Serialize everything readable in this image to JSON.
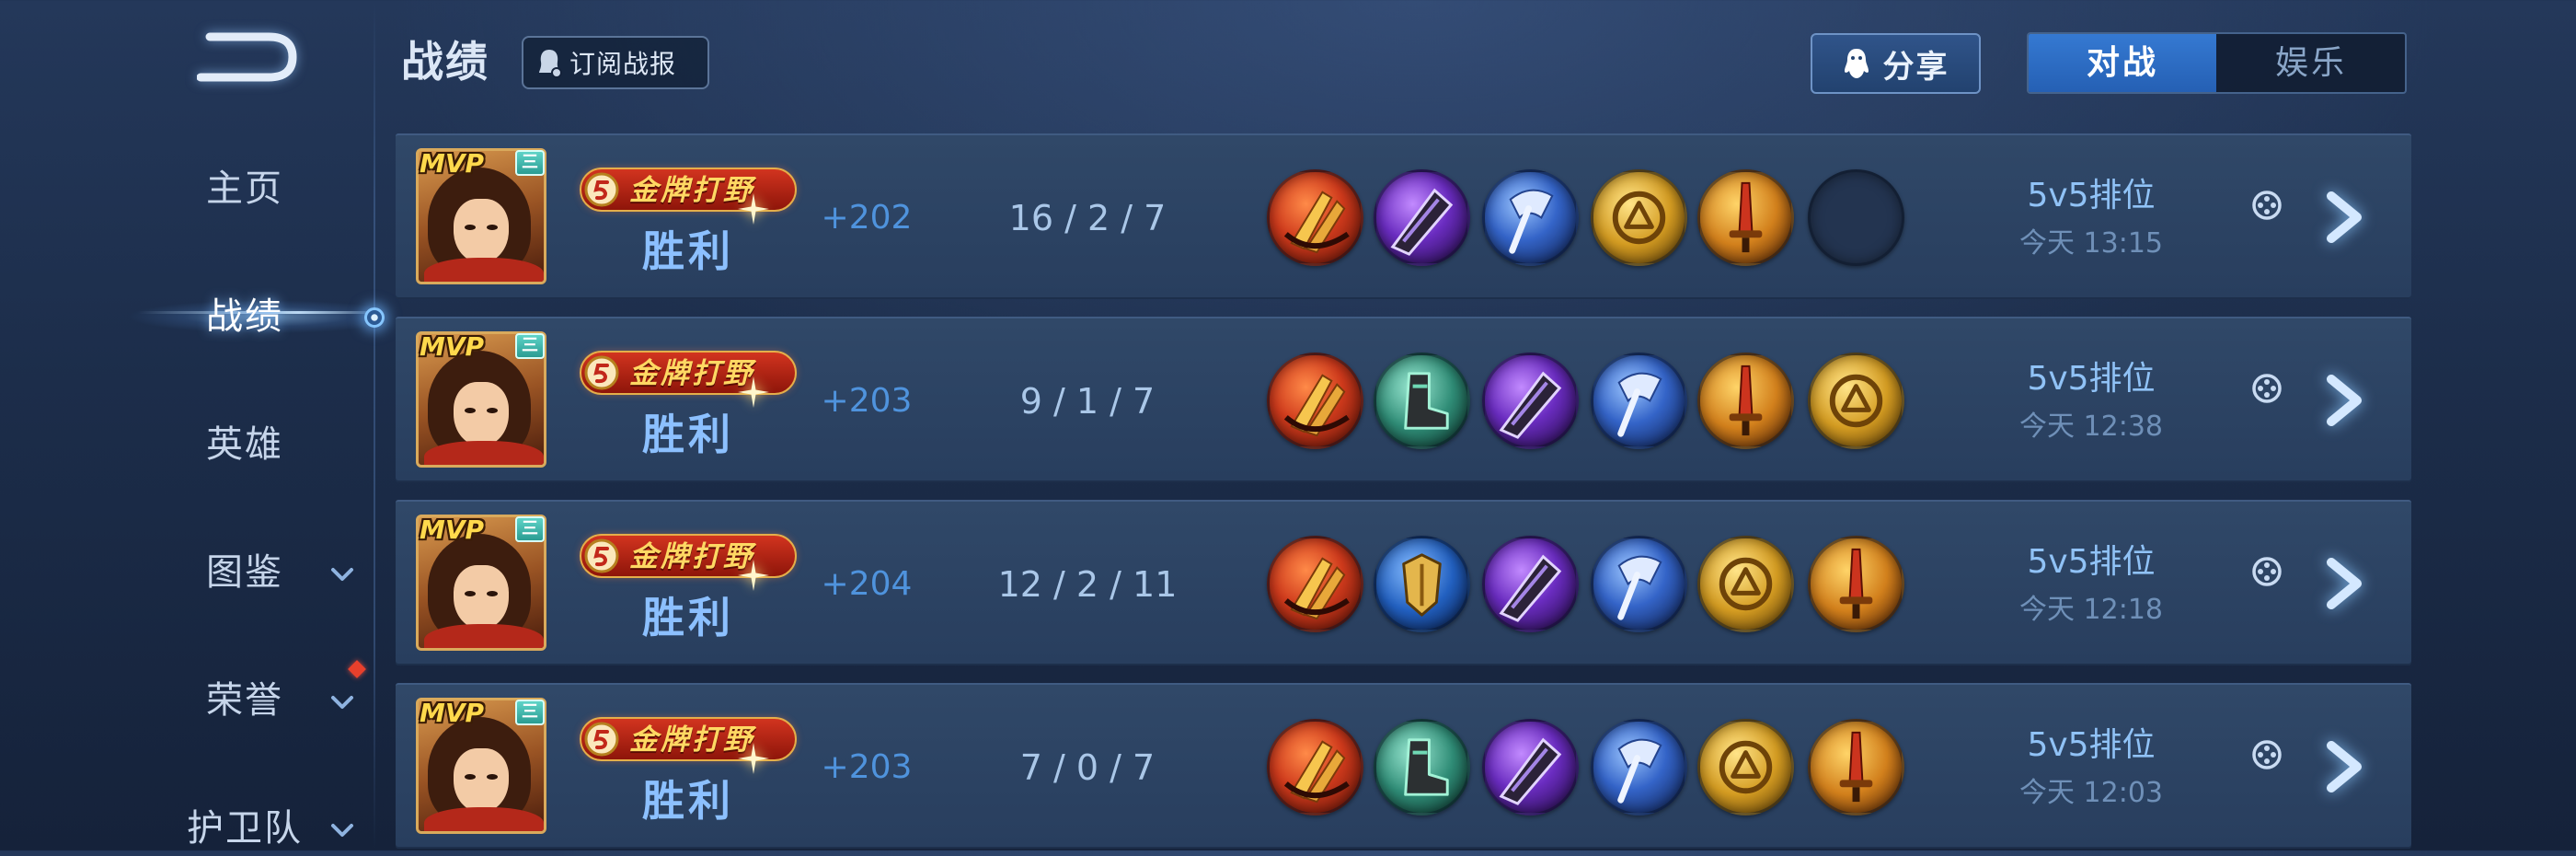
{
  "header": {
    "back_icon": "back-arrow-icon",
    "title": "战绩",
    "subscribe_label": "订阅战报",
    "subscribe_icon": "subscribe-icon",
    "share_label": "分享",
    "share_icon": "qq-penguin-icon"
  },
  "toggle": {
    "options": [
      {
        "label": "对战",
        "selected": true
      },
      {
        "label": "娱乐",
        "selected": false
      }
    ]
  },
  "sidebar": {
    "items": [
      {
        "label": "主页",
        "active": false
      },
      {
        "label": "战绩",
        "active": true
      },
      {
        "label": "英雄",
        "active": false
      },
      {
        "label": "图鉴",
        "active": false,
        "icon": "chevron-down-icon"
      },
      {
        "label": "荣誉",
        "active": false,
        "icon": "chevron-down-icon",
        "badge_icon": "red-dot-icon"
      },
      {
        "label": "护卫队",
        "active": false,
        "icon": "chevron-down-icon"
      }
    ]
  },
  "colors": {
    "score": "#4f93dd",
    "victory": "#8cc0ff",
    "active_tab": "#2b6ec8"
  },
  "matches": [
    {
      "mvp": "MVP",
      "badge": "三",
      "ribbon": "金牌打野",
      "result": "胜利",
      "score": "+202",
      "kda": "16 / 2 / 7",
      "mode": "5v5排位",
      "time": "今天 13:15",
      "equipment": [
        "red-claw",
        "purple-blade",
        "blue-axe",
        "gold-coin",
        "gold-dagger",
        "empty"
      ]
    },
    {
      "mvp": "MVP",
      "badge": "三",
      "ribbon": "金牌打野",
      "result": "胜利",
      "score": "+203",
      "kda": "9 / 1 / 7",
      "mode": "5v5排位",
      "time": "今天 12:38",
      "equipment": [
        "red-claw",
        "green-boots",
        "purple-blade",
        "blue-axe",
        "gold-dagger",
        "gold-coin"
      ]
    },
    {
      "mvp": "MVP",
      "badge": "三",
      "ribbon": "金牌打野",
      "result": "胜利",
      "score": "+204",
      "kda": "12 / 2 / 11",
      "mode": "5v5排位",
      "time": "今天 12:18",
      "equipment": [
        "red-claw",
        "blue-armor",
        "purple-blade",
        "blue-axe",
        "gold-coin",
        "gold-dagger"
      ]
    },
    {
      "mvp": "MVP",
      "badge": "三",
      "ribbon": "金牌打野",
      "result": "胜利",
      "score": "+203",
      "kda": "7 / 0 / 7",
      "mode": "5v5排位",
      "time": "今天 12:03",
      "equipment": [
        "red-claw",
        "green-boots",
        "purple-blade",
        "blue-axe",
        "gold-coin",
        "gold-dagger"
      ]
    }
  ]
}
